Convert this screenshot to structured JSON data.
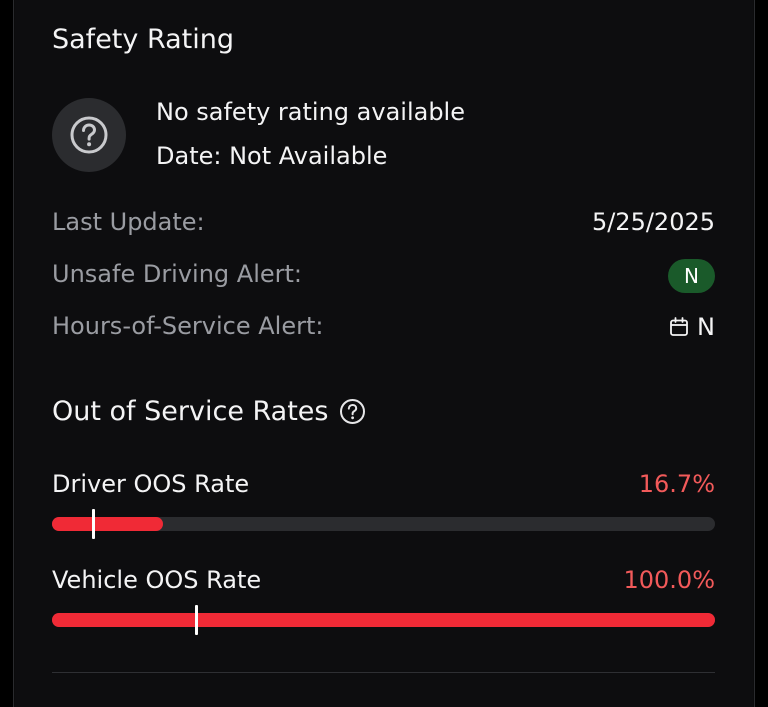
{
  "safety_rating": {
    "title": "Safety Rating",
    "status": "No safety rating available",
    "date": "Date: Not Available",
    "icon": "help-circle-icon"
  },
  "details": [
    {
      "label": "Last Update:",
      "value": "5/25/2025"
    },
    {
      "label": "Unsafe Driving Alert:",
      "value": "N"
    },
    {
      "label": "Hours-of-Service Alert:",
      "value": "N"
    }
  ],
  "colors": {
    "badge_green": "#1a5a2a",
    "rate_red": "#f25a5a",
    "bar_red": "#f02a36",
    "track": "#2b2c2f"
  },
  "oos": {
    "title": "Out of Service Rates",
    "rates": [
      {
        "label": "Driver OOS Rate",
        "value": "16.7%",
        "fill_fraction": 0.167,
        "marker_fraction": 0.06
      },
      {
        "label": "Vehicle OOS Rate",
        "value": "100.0%",
        "fill_fraction": 1.0,
        "marker_fraction": 0.215
      }
    ]
  }
}
